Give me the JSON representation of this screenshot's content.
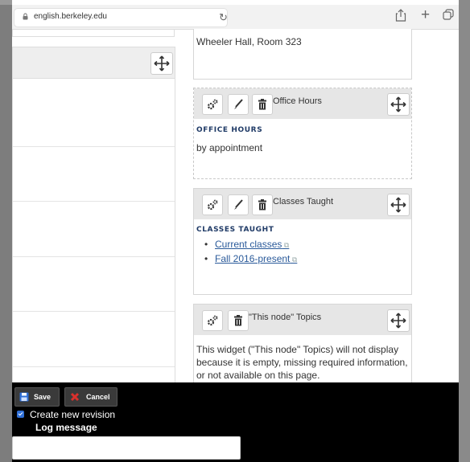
{
  "browser": {
    "url": "english.berkeley.edu"
  },
  "blocks": [
    {
      "address_text": "Wheeler Hall, Room 323"
    },
    {
      "header_title": "Office Hours",
      "body_title": "OFFICE HOURS",
      "body_text": "by appointment"
    },
    {
      "header_title": "Classes Taught",
      "body_title": "CLASSES TAUGHT",
      "links": [
        "Current classes",
        "Fall 2016-present"
      ]
    },
    {
      "header_title": "\"This node\" Topics",
      "body_text": "This widget (\"This node\" Topics) will not display because it is empty, missing required information, or not available on this page."
    }
  ],
  "bottom_bar": {
    "save_label": "Save",
    "cancel_label": "Cancel",
    "revision_label": "Create new revision",
    "revision_checked": true,
    "log_message_label": "Log message",
    "log_message_value": ""
  },
  "colors": {
    "link": "#2a5a9a",
    "block_title": "#1f3a66",
    "save_icon": "#2f6fd6",
    "cancel_icon": "#d9302c"
  },
  "icons": {
    "lock": "lock-icon",
    "reload": "reload-icon",
    "share": "share-icon",
    "new_tab": "plus-icon",
    "tabs": "tabs-icon",
    "move": "move-icon",
    "settings": "gear-icon",
    "edit": "pencil-icon",
    "delete": "trash-icon",
    "save": "floppy-disk-icon",
    "cancel": "x-icon",
    "external": "external-link-icon"
  }
}
